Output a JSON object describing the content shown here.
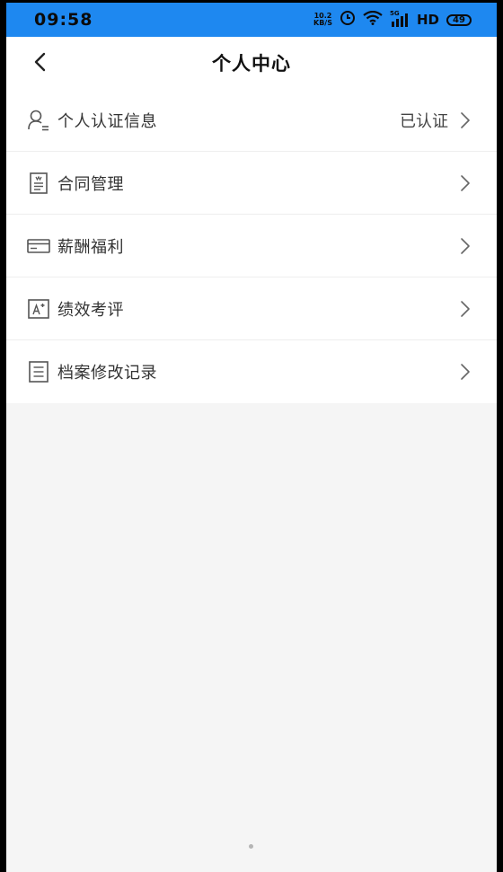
{
  "status_bar": {
    "time": "09:58",
    "net_speed_value": "10.2",
    "net_speed_unit": "KB/S",
    "signal_label": "5G",
    "hd_label": "HD",
    "battery": "49",
    "icons": [
      "alarm-icon",
      "wifi-icon",
      "signal-icon",
      "battery-icon"
    ]
  },
  "header": {
    "title": "个人中心",
    "back_icon": "chevron-left-icon"
  },
  "menu": {
    "items": [
      {
        "label": "个人认证信息",
        "value": "已认证",
        "icon": "user-id-icon"
      },
      {
        "label": "合同管理",
        "value": "",
        "icon": "contract-icon"
      },
      {
        "label": "薪酬福利",
        "value": "",
        "icon": "card-icon"
      },
      {
        "label": "绩效考评",
        "value": "",
        "icon": "grade-icon"
      },
      {
        "label": "档案修改记录",
        "value": "",
        "icon": "document-list-icon"
      }
    ]
  },
  "colors": {
    "status_bar": "#1e88f0",
    "page_background": "#f5f5f5",
    "text": "#333333"
  }
}
